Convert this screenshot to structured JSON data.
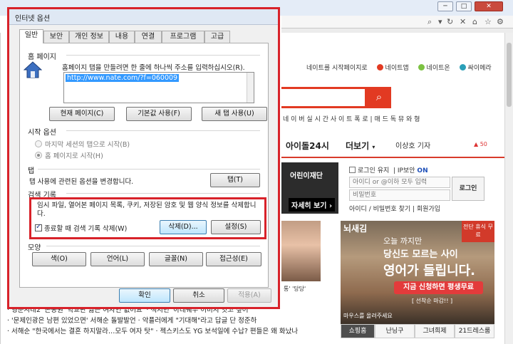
{
  "browser": {
    "toplinks": [
      "네이트를 시작페이지로",
      "네이트앱",
      "네이트온",
      "싸이메라"
    ],
    "search_links": "네 이 버 실 시 간   사 이 트 폭 로  |  매 드 독 뮤 와 형",
    "nav": {
      "item1": "아이돌24시",
      "item2": "더보기",
      "item3": "이상호 기자",
      "item4": "50"
    },
    "banner": {
      "top": "어린이재단",
      "btn": "자세히 보기 ›"
    },
    "login": {
      "remember": "로그인 유지",
      "ip_security": "IP보안",
      "ip_on": "ON",
      "id_placeholder": "아이디 or @이하 모두 입력",
      "pw_placeholder": "비밀번호",
      "login_button": "로그인",
      "links": "아이디 / 비밀번호 찾기  |  회원가입"
    },
    "ad": {
      "logo": "뇌새김",
      "line1": "오늘 까지만",
      "line2": "당신도 모르는 사이",
      "line3": "영어가 들립니다.",
      "cta": "지금 신청하면 평생무료",
      "sub": "[ 선착순 마감!! ]",
      "foot": "마우스를 올려주세요",
      "badge": "전단 휴식 무료"
    },
    "shop_tabs": [
      "쇼핑홈",
      "난닝구",
      "그녀희제",
      "21드레스룸"
    ],
    "photo_caption": "통' '당당'",
    "news": [
      "· 형준시대2' 손동원 '학교판 잃은 여자인 없어요'          · 책지민 '아래쉐우 이미지 잇고 싶어'",
      "· '문제인광은 남편 있었으면' 서해순 돌발발언          · 악플러에게 \"기대해\"라고 답글 단 정준하",
      "· 서해순 \"한국에서는 결혼 하지말라…모두 여자 탓\"          · 젝스키스도 YG 보석일에 수납? 편들은 왜 화났나"
    ]
  },
  "dialog": {
    "title": "인터넷 옵션",
    "tabs": [
      "일반",
      "보안",
      "개인 정보",
      "내용",
      "연결",
      "프로그램",
      "고급"
    ],
    "homepage": {
      "group": "홈 페이지",
      "desc": "홈페이지 탭을 만들려면 한 줄에 하나씩 주소를 입력하십시오(R).",
      "url": "http://www.nate.com/?f=060009",
      "btn_current": "현재 페이지(C)",
      "btn_default": "기본값 사용(F)",
      "btn_newtab": "새 탭 사용(U)"
    },
    "startup": {
      "group": "시작 옵션",
      "opt1": "마지막 세션의 탭으로 시작(B)",
      "opt2": "홈 페이지로 시작(H)"
    },
    "tabs_group": {
      "group": "탭",
      "desc": "탭 사용에 관련된 옵션을 변경합니다.",
      "btn": "탭(T)"
    },
    "history": {
      "group": "검색 기록",
      "desc": "임시 파일, 열어본 페이지 목록, 쿠키, 저장된 암호 및 웹 양식 정보를 삭제합니다.",
      "checkbox": "종료할 때 검색 기록 삭제(W)",
      "btn_delete": "삭제(D)...",
      "btn_settings": "설정(S)"
    },
    "appearance": {
      "group": "모양",
      "btn_color": "색(O)",
      "btn_lang": "언어(L)",
      "btn_font": "글꼴(N)",
      "btn_access": "접근성(E)"
    },
    "footer": {
      "ok": "확인",
      "cancel": "취소",
      "apply": "적용(A)"
    }
  }
}
